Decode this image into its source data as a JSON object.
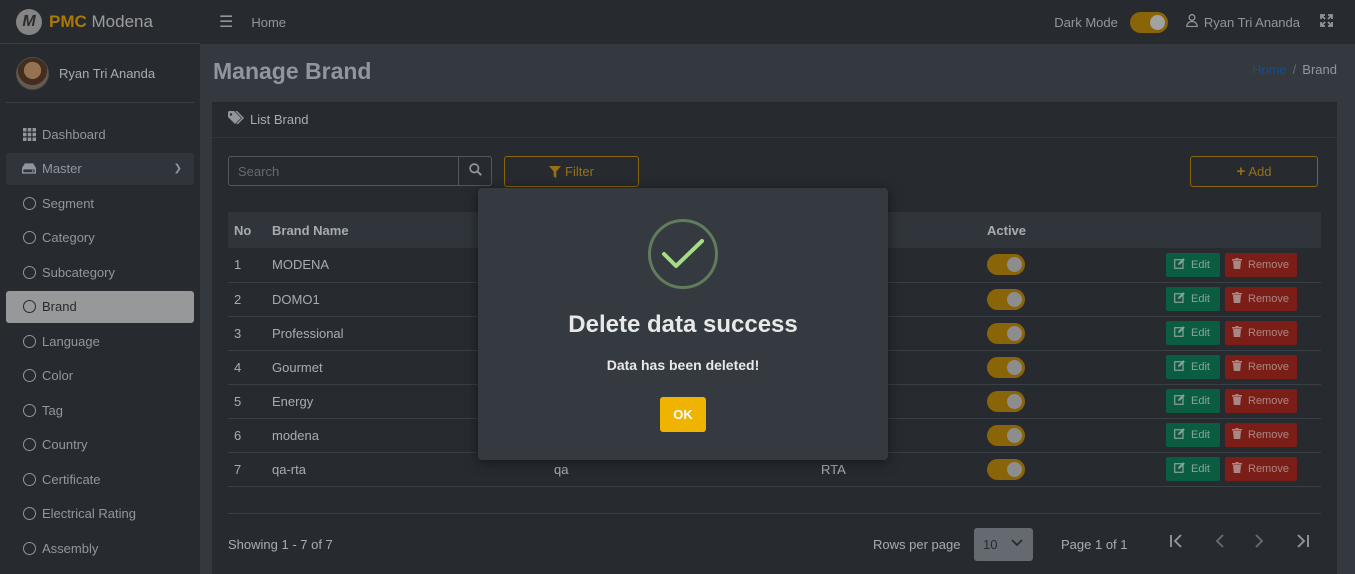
{
  "app": {
    "brand_bold": "PMC",
    "brand_rest": " Modena",
    "logo_letter": "M"
  },
  "user": {
    "name": "Ryan Tri Ananda"
  },
  "sidebar": {
    "items": [
      {
        "label": "Dashboard",
        "icon": "grid-icon"
      },
      {
        "label": "Master",
        "icon": "drive-icon"
      },
      {
        "label": "Segment"
      },
      {
        "label": "Category"
      },
      {
        "label": "Subcategory"
      },
      {
        "label": "Brand"
      },
      {
        "label": "Language"
      },
      {
        "label": "Color"
      },
      {
        "label": "Tag"
      },
      {
        "label": "Country"
      },
      {
        "label": "Certificate"
      },
      {
        "label": "Electrical Rating"
      },
      {
        "label": "Assembly"
      }
    ]
  },
  "header": {
    "home": "Home",
    "dark_mode": "Dark Mode",
    "user_name": "Ryan Tri Ananda"
  },
  "page": {
    "title": "Manage Brand",
    "breadcrumb_home": "Home",
    "breadcrumb_sep": "/",
    "breadcrumb_current": "Brand"
  },
  "card": {
    "title": "List Brand"
  },
  "toolbar": {
    "search_placeholder": "Search",
    "filter": "Filter",
    "add": "Add"
  },
  "table": {
    "headers": {
      "no": "No",
      "name": "Brand Name",
      "active": "Active"
    },
    "rows": [
      {
        "no": "1",
        "name": "MODENA",
        "code": "",
        "user": ""
      },
      {
        "no": "2",
        "name": "DOMO1",
        "code": "",
        "user": ""
      },
      {
        "no": "3",
        "name": "Professional",
        "code": "",
        "user": ""
      },
      {
        "no": "4",
        "name": "Gourmet",
        "code": "",
        "user": ""
      },
      {
        "no": "5",
        "name": "Energy",
        "code": "",
        "user": ""
      },
      {
        "no": "6",
        "name": "modena",
        "code": "",
        "user": ""
      },
      {
        "no": "7",
        "name": "qa-rta",
        "code": "qa",
        "user": "RTA"
      }
    ],
    "edit_label": "Edit",
    "remove_label": "Remove"
  },
  "footer": {
    "showing": "Showing 1 - 7 of 7",
    "rows_per_page_label": "Rows per page",
    "rows_per_page": "10",
    "page_info": "Page 1 of 1"
  },
  "modal": {
    "title": "Delete data success",
    "text": "Data has been deleted!",
    "ok": "OK"
  },
  "colors": {
    "accent": "#b8860b",
    "edit": "#0f7d59",
    "remove": "#a5291f",
    "ok": "#f0b400"
  }
}
